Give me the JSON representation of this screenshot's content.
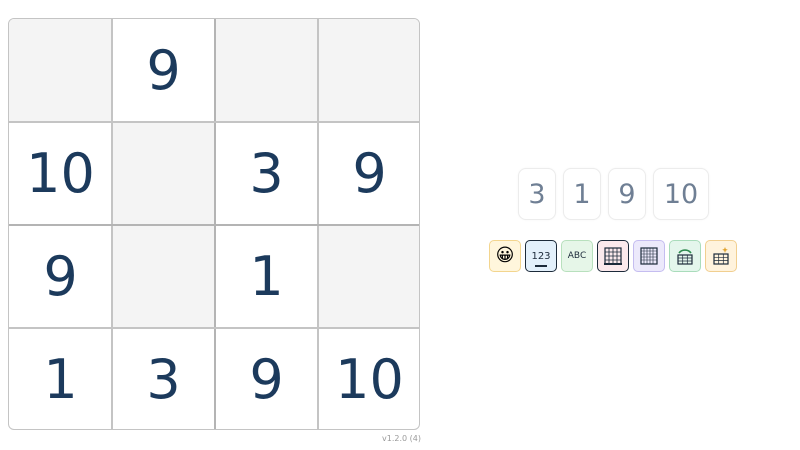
{
  "board": {
    "rows": [
      [
        "",
        "9",
        "",
        ""
      ],
      [
        "10",
        "",
        "3",
        "9"
      ],
      [
        "9",
        "",
        "1",
        ""
      ],
      [
        "1",
        "3",
        "9",
        "10"
      ]
    ]
  },
  "version": "v1.2.0 (4)",
  "choices": [
    "3",
    "1",
    "9",
    "10"
  ],
  "tools": {
    "emoji": "😀",
    "numbers_label": "123",
    "letters_label": "ABC",
    "colors": {
      "yellow": "#fff6dc",
      "blue": "#e3f0fb",
      "green": "#e6f6e8",
      "pink": "#fbe9ec",
      "lavender": "#ece9fb",
      "mint": "#e4f6ec",
      "cream": "#fff3dd"
    },
    "icons": [
      "emoji-icon",
      "numbers-icon",
      "letters-icon",
      "grid-icon",
      "grid-dense-icon",
      "grid-rotate-icon",
      "grid-sparkle-icon"
    ]
  },
  "theme": {
    "digit_color": "#1c3a5c",
    "choice_color": "#6f7f94",
    "empty_cell": "#f4f4f4",
    "border": "#c4c4c4"
  }
}
